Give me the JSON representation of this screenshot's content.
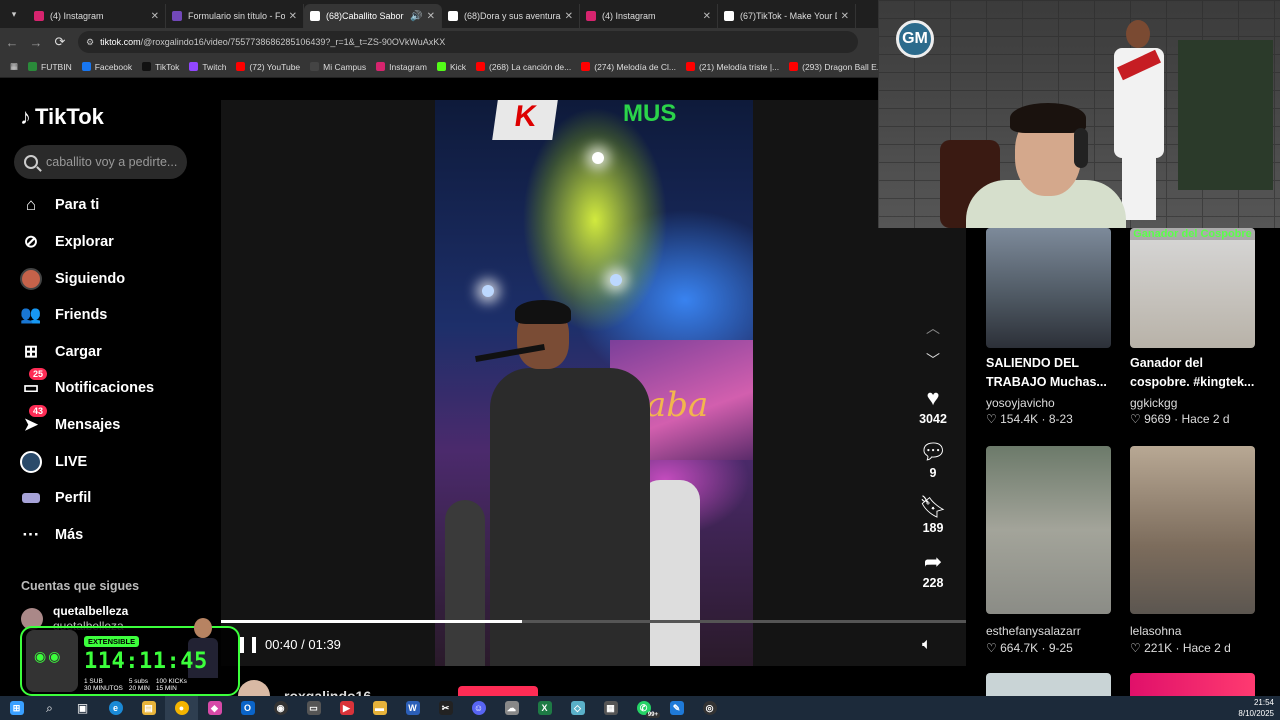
{
  "browser": {
    "tabs": [
      {
        "title": "(4) Instagram",
        "color": "#d6246e"
      },
      {
        "title": "Formulario sin título - For",
        "color": "#7248b9"
      },
      {
        "title": "(68)Caballito Sabor de",
        "color": "#ffffff",
        "active": true
      },
      {
        "title": "(68)Dora y sus aventuras",
        "color": "#ffffff"
      },
      {
        "title": "(4) Instagram",
        "color": "#d6246e"
      },
      {
        "title": "(67)TikTok - Make Your D",
        "color": "#ffffff"
      }
    ],
    "url_host": "tiktok.com",
    "url_path": "/@roxgalindo16/video/7557738686285106439?_r=1&_t=ZS-90OVkWuAxKX",
    "bookmarks": [
      {
        "label": "FUTBIN",
        "color": "#2a8a3a"
      },
      {
        "label": "Facebook",
        "color": "#1877f2"
      },
      {
        "label": "TikTok",
        "color": "#111111"
      },
      {
        "label": "Twitch",
        "color": "#9146ff"
      },
      {
        "label": "(72) YouTube",
        "color": "#ff0000"
      },
      {
        "label": "Mi Campus",
        "color": "#444444"
      },
      {
        "label": "Instagram",
        "color": "#d6246e"
      },
      {
        "label": "Kick",
        "color": "#53fc18"
      },
      {
        "label": "(268) La canción de...",
        "color": "#ff0000"
      },
      {
        "label": "(274) Melodía de Cl...",
        "color": "#ff0000"
      },
      {
        "label": "(21) Melodía triste |...",
        "color": "#ff0000"
      },
      {
        "label": "(293) Dragon Ball E...",
        "color": "#ff0000"
      }
    ]
  },
  "tiktok": {
    "logo": "TikTok",
    "search_placeholder": "caballito voy a pedirte...",
    "nav": [
      {
        "label": "Para ti",
        "icon": "home-icon"
      },
      {
        "label": "Explorar",
        "icon": "compass-icon"
      },
      {
        "label": "Siguiendo",
        "icon": "following-avatar-icon"
      },
      {
        "label": "Friends",
        "icon": "friends-icon"
      },
      {
        "label": "Cargar",
        "icon": "upload-icon"
      },
      {
        "label": "Notificaciones",
        "icon": "inbox-icon",
        "badge": "25"
      },
      {
        "label": "Mensajes",
        "icon": "messages-icon",
        "badge": "43"
      },
      {
        "label": "LIVE",
        "icon": "live-icon"
      },
      {
        "label": "Perfil",
        "icon": "profile-icon"
      },
      {
        "label": "Más",
        "icon": "more-icon"
      }
    ],
    "following_title": "Cuentas que sigues",
    "following": [
      {
        "name": "quetalbelleza",
        "handle": "quetalbelleza"
      }
    ],
    "player": {
      "current": "00:40",
      "duration": "01:39",
      "time_display": "00:40 / 01:39",
      "progress": 0.404,
      "author": "roxgalindo16"
    },
    "actions": {
      "likes": "3042",
      "comments": "9",
      "saves": "189",
      "shares": "228"
    },
    "video_text": {
      "sign": "MUS",
      "banner": "Caba"
    },
    "suggestions": [
      {
        "title": "SALIENDO DEL TRABAJO Muchas...",
        "author": "yosoyjavicho",
        "likes": "154.4K",
        "date": "8-23",
        "overlay": ""
      },
      {
        "title": "Ganador del cospobre. #kingtek...",
        "author": "ggkickgg",
        "likes": "9669",
        "date": "Hace 2 d",
        "overlay": "Ganador del Cospobre"
      },
      {
        "title": "",
        "author": "esthefanysalazarr",
        "likes": "664.7K",
        "date": "9-25",
        "overlay": ""
      },
      {
        "title": "",
        "author": "lelasohna",
        "likes": "221K",
        "date": "Hace 2 d",
        "overlay": ""
      }
    ]
  },
  "stream_overlay": {
    "webcam_logo": "GM",
    "timer_tag": "EXTENSIBLE",
    "timer": "114:11:45",
    "rates": [
      {
        "top": "1 SUB",
        "bottom": "30 MINUTOS"
      },
      {
        "top": "5 subs",
        "bottom": "20 MIN"
      },
      {
        "top": "100 KICKs",
        "bottom": "15 MIN"
      }
    ]
  },
  "taskbar": {
    "notification_count": "99+",
    "time": "21:54",
    "date": "8/10/2025"
  }
}
